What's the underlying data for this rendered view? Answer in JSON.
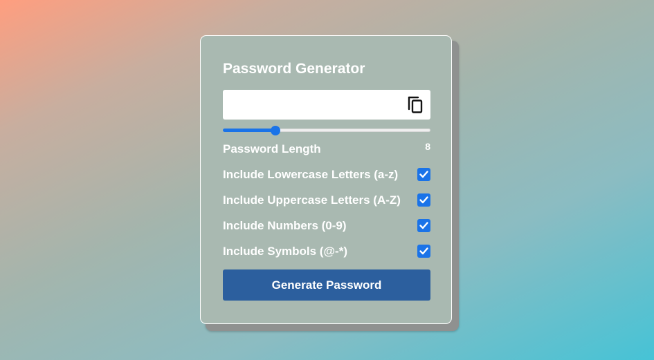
{
  "app": {
    "title": "Password Generator"
  },
  "password": {
    "value": "",
    "copy_icon": "copy-icon"
  },
  "length": {
    "label": "Password Length",
    "value": 8,
    "value_text": "8",
    "min": 1,
    "max": 30
  },
  "options": [
    {
      "label": "Include Lowercase Letters (a-z)",
      "checked": true
    },
    {
      "label": "Include Uppercase Letters (A-Z)",
      "checked": true
    },
    {
      "label": "Include Numbers (0-9)",
      "checked": true
    },
    {
      "label": "Include Symbols (@-*)",
      "checked": true
    }
  ],
  "generate_button": {
    "label": "Generate Password"
  },
  "colors": {
    "accent": "#1a73e8",
    "button": "#2c5f9e",
    "text": "#ffffff"
  }
}
